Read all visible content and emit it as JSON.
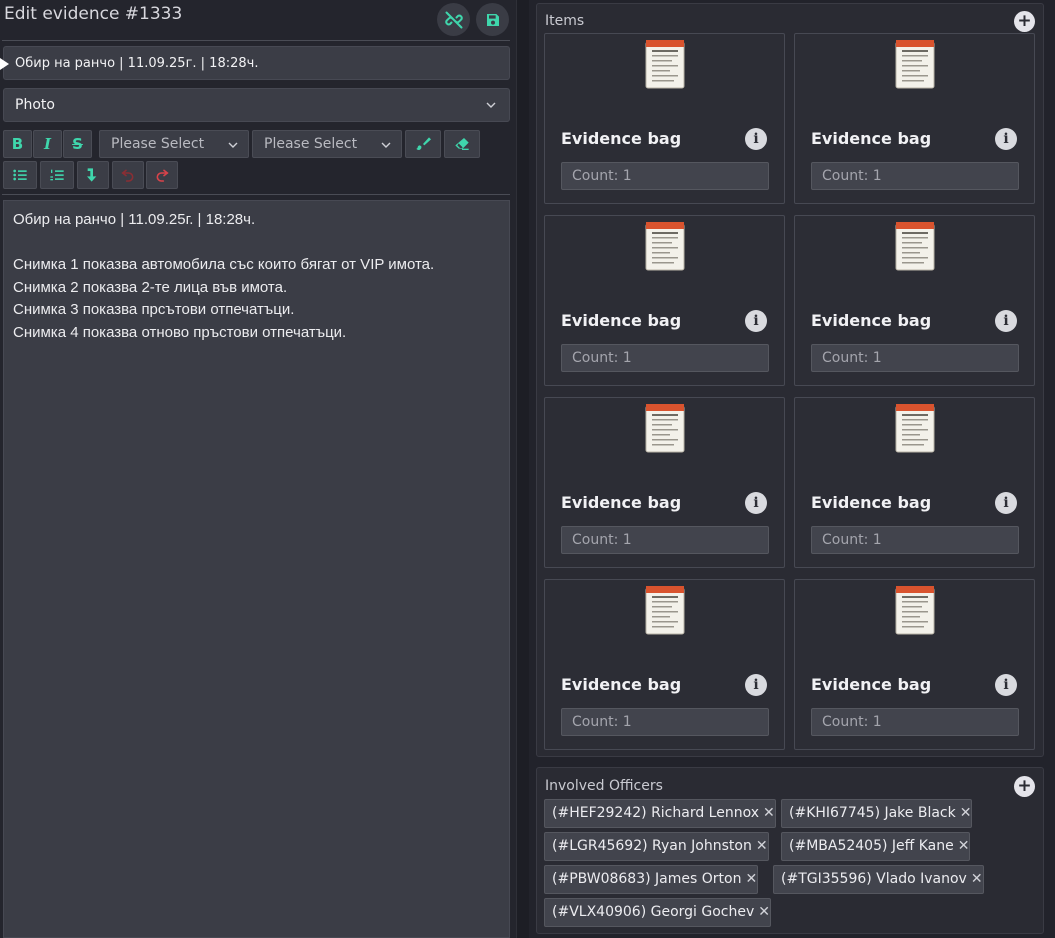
{
  "editor": {
    "title": "Edit evidence #1333",
    "title_input": "Обир на ранчо | 11.09.25г. | 18:28ч.",
    "type_select": "Photo",
    "toolbar": {
      "bold": "B",
      "italic": "I",
      "strike": "S",
      "select1": "Please Select",
      "select2": "Please Select"
    },
    "body_text": "Обир на ранчо | 11.09.25г. | 18:28ч.\n\nСнимка 1 показва автомобила със които бягат от VIP имота.\nСнимка 2 показва 2-те лица във имота.\nСнимка 3 показва прсътови отпечатъци.\nСнимка 4 показва отново пръстови отпечатъци."
  },
  "items": {
    "label": "Items",
    "list": [
      {
        "name": "Evidence bag",
        "count": "Count: 1"
      },
      {
        "name": "Evidence bag",
        "count": "Count: 1"
      },
      {
        "name": "Evidence bag",
        "count": "Count: 1"
      },
      {
        "name": "Evidence bag",
        "count": "Count: 1"
      },
      {
        "name": "Evidence bag",
        "count": "Count: 1"
      },
      {
        "name": "Evidence bag",
        "count": "Count: 1"
      },
      {
        "name": "Evidence bag",
        "count": "Count: 1"
      },
      {
        "name": "Evidence bag",
        "count": "Count: 1"
      }
    ]
  },
  "officers": {
    "label": "Involved Officers",
    "list": [
      "(#HEF29242) Richard Lennox",
      "(#KHI67745) Jake Black",
      "(#LGR45692) Ryan Johnston",
      "(#MBA52405) Jeff Kane",
      "(#PBW08683) James Orton",
      "(#TGI35596) Vlado Ivanov",
      "(#VLX40906) Georgi Gochev"
    ]
  },
  "colors": {
    "accent": "#3fd6ac",
    "danger": "#d9434a",
    "background": "#22232b"
  },
  "icons": [
    "unlink-icon",
    "save-icon",
    "paint-brush-icon",
    "eraser-icon",
    "bullet-list-icon",
    "numbered-list-icon",
    "arrow-down-icon",
    "undo-icon",
    "redo-icon",
    "info-icon",
    "plus-icon",
    "close-icon"
  ]
}
